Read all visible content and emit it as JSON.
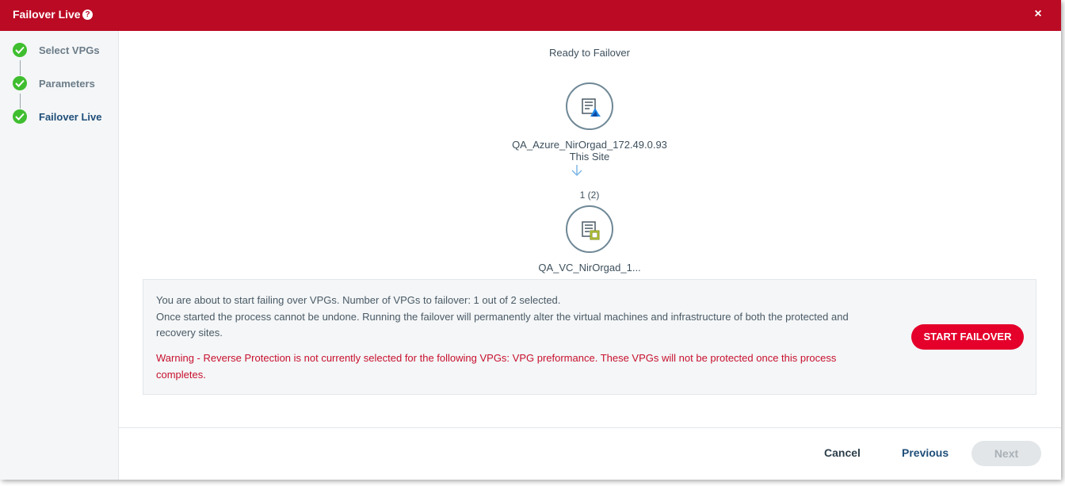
{
  "dialog": {
    "title": "Failover Live",
    "help_glyph": "?",
    "close_glyph": "×"
  },
  "steps": [
    {
      "label": "Select VPGs",
      "state": "completed"
    },
    {
      "label": "Parameters",
      "state": "completed"
    },
    {
      "label": "Failover Live",
      "state": "completed",
      "active": true
    }
  ],
  "topology": {
    "status": "Ready to Failover",
    "source": {
      "name": "QA_Azure_NirOrgad_172.49.0.93",
      "subtitle": "This Site",
      "icon": "azure-site-icon"
    },
    "count": "1 (2)",
    "target": {
      "name": "QA_VC_NirOrgad_1...",
      "icon": "vcenter-site-icon"
    }
  },
  "info": {
    "line1": "You are about to start failing over VPGs. Number of VPGs to failover: 1 out of 2 selected.",
    "line2": "Once started the process cannot be undone. Running the failover will permanently alter the virtual machines and infrastructure of both the protected and recovery sites.",
    "warning": "Warning - Reverse Protection is not currently selected for the following VPGs: VPG preformance. These VPGs will not be protected once this process completes.",
    "start_button": "START FAILOVER"
  },
  "footer": {
    "cancel": "Cancel",
    "previous": "Previous",
    "next": "Next"
  },
  "colors": {
    "header": "#bb0a24",
    "check": "#3fbe2f",
    "primary_button": "#e4002b",
    "warning_text": "#c8102e"
  }
}
